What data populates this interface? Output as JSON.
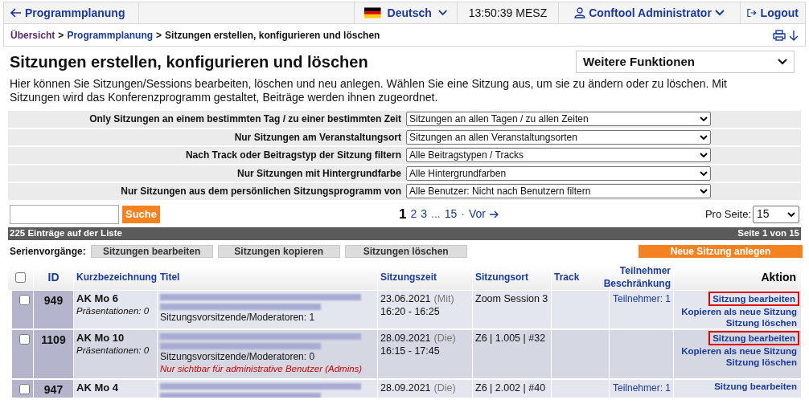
{
  "topbar": {
    "back": "Programmplanung",
    "language": "Deutsch",
    "time": "13:50:39",
    "timezone": "MESZ",
    "user": "Conftool Administrator",
    "logout": "Logout"
  },
  "breadcrumb": [
    "Übersicht",
    "Programmplanung",
    "Sitzungen erstellen, konfigurieren und löschen"
  ],
  "breadcrumb_separator": ">",
  "heading": "Sitzungen erstellen, konfigurieren und löschen",
  "more_functions": "Weitere Funktionen",
  "description": "Hier können Sie Sitzungen/Sessions bearbeiten, löschen und neu anlegen. Wählen Sie eine Sitzung aus, um sie zu ändern oder zu löschen. Mit Sitzungen wird das Konferenzprogramm gestaltet, Beiträge werden ihnen zugeordnet.",
  "filters": [
    {
      "label": "Only Sitzungen an einem bestimmten Tag / zu einer bestimmten Zeit",
      "value": "Sitzungen an allen Tagen / zu allen Zeiten"
    },
    {
      "label": "Nur Sitzungen am Veranstaltungsort",
      "value": "Sitzungen an allen Veranstaltungsorten"
    },
    {
      "label": "Nach Track oder Beitragstyp der Sitzung filtern",
      "value": "Alle Beitragstypen / Tracks"
    },
    {
      "label": "Nur Sitzungen mit Hintergrundfarbe",
      "value": "Alle Hintergrundfarben"
    },
    {
      "label": "Nur Sitzungen aus dem persönlichen Sitzungsprogramm von",
      "value": "Alle Benutzer: Nicht nach Benutzern filtern"
    }
  ],
  "search_button": "Suche",
  "pagination": [
    {
      "label": "1",
      "selected": true
    },
    {
      "label": "2",
      "selected": false
    },
    {
      "label": "3",
      "selected": false
    },
    {
      "label": "...",
      "kind": "gap"
    },
    {
      "label": "15",
      "selected": false
    }
  ],
  "pagination_sep": "·",
  "next": "Vor",
  "per_page_label": "Pro Seite:",
  "per_page": "15",
  "list_count": "225 Einträge auf der Liste",
  "page_info": "Seite 1 von 15",
  "bulk_label": "Serienvorgänge:",
  "bulk_actions": [
    "Sitzungen bearbeiten",
    "Sitzungen kopieren",
    "Sitzungen löschen"
  ],
  "new_session": "Neue Sitzung anlegen",
  "table": {
    "select_all_checked": false,
    "columns": [
      "ID",
      "Kurzbezeichnung",
      "Titel",
      "Sitzungszeit",
      "Sitzungsort",
      "Track",
      "Teilnehmer Beschränkung",
      "Aktion"
    ],
    "rows": [
      {
        "checked": false,
        "id": "949",
        "short": "AK Mo 6",
        "presentations": "Präsentationen: 0",
        "chairs": "Sitzungsvorsitzende/Moderatoren: 1",
        "admin_note": null,
        "date": "23.06.2021",
        "weekday": "(Mit)",
        "time": "16:20 - 16:25",
        "location": "Zoom Session 3",
        "participants": "Teilnehmer: 1",
        "actions": [
          {
            "label": "Sitzung bearbeiten",
            "highlighted": true
          },
          {
            "label": "Kopieren als neue Sitzung",
            "highlighted": false
          },
          {
            "label": "Sitzung löschen",
            "highlighted": false
          }
        ]
      },
      {
        "checked": false,
        "id": "1109",
        "short": "AK Mo 10",
        "presentations": "Präsentationen: 0",
        "chairs": "Sitzungsvorsitzende/Moderatoren: 0",
        "admin_note": "Nur sichtbar für administrative Benutzer (Admins)",
        "date": "28.09.2021",
        "weekday": "(Die)",
        "time": "16:15 - 17:45",
        "location": "Z6 | 1.005 | #32",
        "participants": null,
        "actions": [
          {
            "label": "Sitzung bearbeiten",
            "highlighted": true
          },
          {
            "label": "Kopieren als neue Sitzung",
            "highlighted": false
          },
          {
            "label": "Sitzung löschen",
            "highlighted": false
          }
        ]
      },
      {
        "checked": false,
        "id": "947",
        "short": "AK Mo 4",
        "presentations": null,
        "chairs": null,
        "admin_note": null,
        "date": "28.09.2021",
        "weekday": "(Die)",
        "time": null,
        "location": "Z6 | 2.002 | #40",
        "participants": "Teilnehmer: 1",
        "actions": [
          {
            "label": "Sitzung bearbeiten",
            "highlighted": false
          }
        ]
      }
    ]
  }
}
